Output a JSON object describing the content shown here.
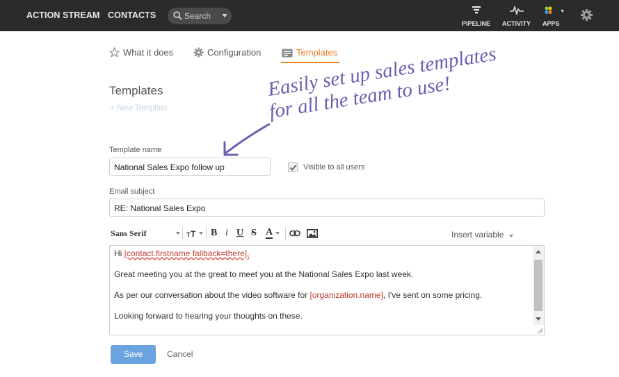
{
  "topbar": {
    "nav": [
      "ACTION STREAM",
      "CONTACTS"
    ],
    "search_placeholder": "Search",
    "pipeline_label": "PIPELINE",
    "activity_label": "ACTIVITY",
    "apps_label": "APPS"
  },
  "tabs": {
    "what_it_does": "What it does",
    "configuration": "Configuration",
    "templates": "Templates"
  },
  "annotation": {
    "line1": "Easily set up sales templates",
    "line2": "for all the team to use!"
  },
  "page": {
    "heading": "Templates",
    "new_template": "+ New Template"
  },
  "form": {
    "template_name_label": "Template name",
    "template_name_value": "National Sales Expo follow up",
    "visible_label": "Visible to all users",
    "visible_checked": true,
    "subject_label": "Email subject",
    "subject_value": "RE: National Sales Expo"
  },
  "toolbar": {
    "font": "Sans Serif",
    "size_icon": "text-size-icon",
    "bold": "B",
    "italic": "i",
    "underline": "U",
    "strike": "S",
    "color": "A",
    "insert_variable": "Insert variable"
  },
  "editor": {
    "line1_prefix": "Hi ",
    "line1_var": "[contact.firstname fallback=there],",
    "line2": "Great meeting you at the great to meet you at the National Sales Expo last week.",
    "line3_prefix": "As per our conversation about the video software for ",
    "line3_var": "[organization.name]",
    "line3_suffix": ", I've sent on some pricing.",
    "line4": "Looking forward to hearing your thoughts on these."
  },
  "buttons": {
    "save": "Save",
    "cancel": "Cancel"
  },
  "colors": {
    "accent": "#e67e22",
    "primary_button": "#6aa3e0",
    "variable": "#c0392b",
    "annotation": "#6a5fb0"
  }
}
